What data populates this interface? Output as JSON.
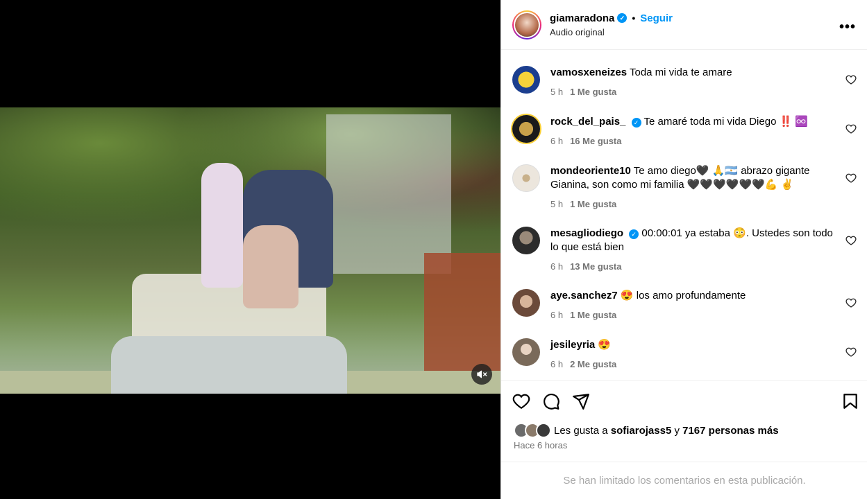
{
  "header": {
    "username": "giamaradona",
    "follow_label": "Seguir",
    "dot": "•",
    "audio": "Audio original",
    "more_icon": "more-icon"
  },
  "comments": [
    {
      "user": "vamosxeneizes",
      "text": "Toda mi vida te amare",
      "time": "5 h",
      "likes": "1 Me gusta",
      "verified": false,
      "avatar_color": "#1b3e8f"
    },
    {
      "user": "rock_del_pais_",
      "text": "Te amaré toda mi vida Diego ‼️ ♾️",
      "time": "6 h",
      "likes": "16 Me gusta",
      "verified": true,
      "avatar_color": "#1a1a1a"
    },
    {
      "user": "mondeoriente10",
      "text": "Te amo diego🖤 🙏🇦🇷 abrazo gigante Gianina, son como mi familia 🖤🖤🖤🖤🖤🖤💪 ✌️",
      "time": "5 h",
      "likes": "1 Me gusta",
      "verified": false,
      "avatar_color": "#e9e4dc"
    },
    {
      "user": "mesagliodiego",
      "text": "00:00:01 ya estaba 😳. Ustedes son todo lo que está bien",
      "time": "6 h",
      "likes": "13 Me gusta",
      "verified": true,
      "avatar_color": "#2c2c2c"
    },
    {
      "user": "aye.sanchez7",
      "text": "😍 los amo profundamente",
      "time": "6 h",
      "likes": "1 Me gusta",
      "verified": false,
      "avatar_color": "#6b4a3a"
    },
    {
      "user": "jesileyria",
      "text": "😍",
      "time": "6 h",
      "likes": "2 Me gusta",
      "verified": false,
      "avatar_color": "#7a6a5a"
    }
  ],
  "actions": {
    "likes_prefix": "Les gusta a",
    "liked_by": "sofiarojass5",
    "and": "y",
    "others": "7167 personas más",
    "time": "Hace 6 horas"
  },
  "limited_text": "Se han limitado los comentarios en esta publicación.",
  "colors": {
    "accent": "#0095f6",
    "meta": "#737373",
    "muted": "#a8a8a8"
  }
}
